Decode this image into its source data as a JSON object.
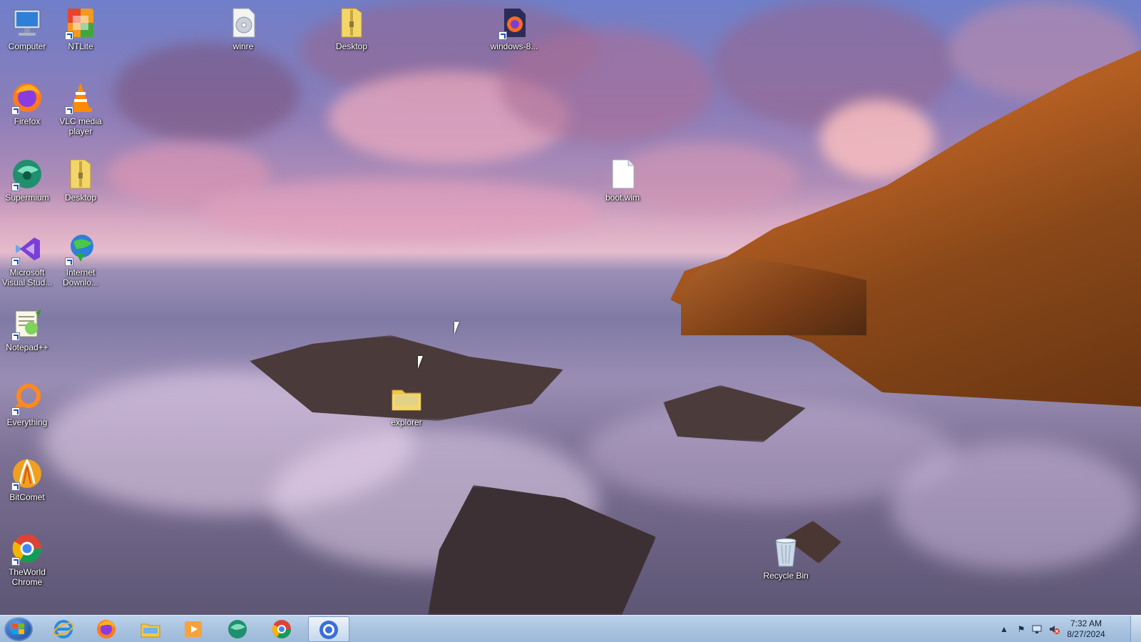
{
  "desktop": {
    "icons": [
      {
        "label": "Computer",
        "icon": "computer-icon"
      },
      {
        "label": "NTLite",
        "icon": "ntlite-icon"
      },
      {
        "label": "winre",
        "icon": "disc-image-icon"
      },
      {
        "label": "Desktop",
        "icon": "folder-zip-icon"
      },
      {
        "label": "windows-8...",
        "icon": "firefox-document-icon"
      },
      {
        "label": "Firefox",
        "icon": "firefox-icon"
      },
      {
        "label": "VLC media player",
        "icon": "vlc-icon"
      },
      {
        "label": "Supermium",
        "icon": "supermium-icon"
      },
      {
        "label": "Desktop",
        "icon": "folder-zip-icon"
      },
      {
        "label": "boot.wim",
        "icon": "blank-file-icon"
      },
      {
        "label": "Microsoft Visual Stud...",
        "icon": "visual-studio-icon"
      },
      {
        "label": "Internet Downlo...",
        "icon": "internet-download-manager-icon"
      },
      {
        "label": "Notepad++",
        "icon": "notepad-plus-plus-icon"
      },
      {
        "label": "Everything",
        "icon": "everything-search-icon"
      },
      {
        "label": "explorer",
        "icon": "folder-icon"
      },
      {
        "label": "BitComet",
        "icon": "bitcomet-icon"
      },
      {
        "label": "TheWorld Chrome",
        "icon": "theworld-chrome-icon"
      },
      {
        "label": "Recycle Bin",
        "icon": "recycle-bin-icon"
      }
    ]
  },
  "taskbar": {
    "start_icon": "windows-start-icon",
    "pinned": [
      {
        "icon": "internet-explorer-icon",
        "active": false
      },
      {
        "icon": "firefox-icon",
        "active": false
      },
      {
        "icon": "file-explorer-icon",
        "active": false
      },
      {
        "icon": "media-player-icon",
        "active": false
      },
      {
        "icon": "supermium-icon",
        "active": false
      },
      {
        "icon": "theworld-chrome-icon",
        "active": false
      },
      {
        "icon": "chrome-icon",
        "active": true
      }
    ],
    "tray": {
      "icons": [
        "show-hidden-icons-arrow",
        "action-center-flag-icon",
        "network-icon",
        "volume-muted-icon"
      ],
      "time": "7:32 AM",
      "date": "8/27/2024"
    }
  }
}
